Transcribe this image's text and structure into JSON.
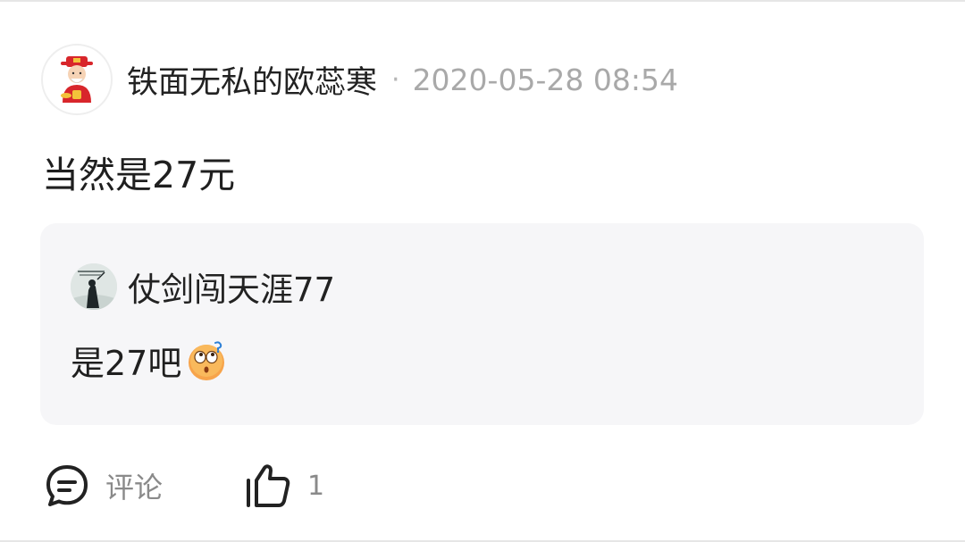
{
  "post": {
    "author": "铁面无私的欧蕊寒",
    "separator": "·",
    "timestamp": "2020-05-28 08:54",
    "content": "当然是27元",
    "avatar_icon": "god-of-wealth-avatar-icon"
  },
  "reply": {
    "author": "仗剑闯天涯77",
    "content": "是27吧",
    "avatar_icon": "swordsman-avatar-icon",
    "emoji_icon": "thinking-face-emoji-icon"
  },
  "actions": {
    "comment_label": "评论",
    "like_count": "1",
    "comment_icon": "comment-bubble-icon",
    "like_icon": "thumbs-up-icon"
  },
  "colors": {
    "text_primary": "#222222",
    "text_secondary": "#a9a9a9",
    "reply_bg": "#f6f6f8"
  }
}
